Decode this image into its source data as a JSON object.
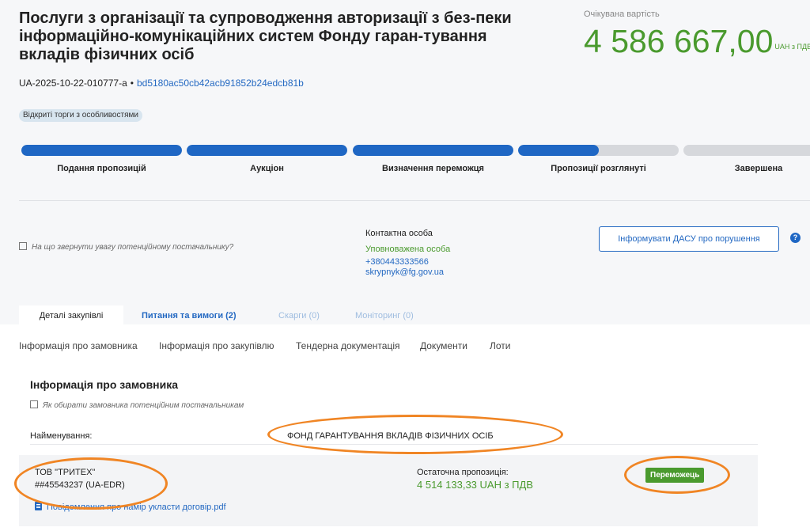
{
  "tender": {
    "title": "Послуги з організації та супроводження авторизації з без-пеки інформаційно-комунікаційних систем Фонду гаран-тування вкладів фізичних осіб",
    "id": "UA-2025-10-22-010777-a",
    "separator": "•",
    "hash": "bd5180ac50cb42acb91852b24edcb81b",
    "procedure_badge": "Відкриті торги з особливостями"
  },
  "expected_value": {
    "label": "Очікувана вартість",
    "amount": "4 586 667,00",
    "currency": "UAH з ПДВ"
  },
  "stages": [
    {
      "label": "Подання пропозицій",
      "progress": 1.0
    },
    {
      "label": "Аукціон",
      "progress": 1.0
    },
    {
      "label": "Визначення переможця",
      "progress": 1.0
    },
    {
      "label": "Пропозиції розглянуті",
      "progress": 0.5
    },
    {
      "label": "Завершена",
      "progress": 0.0
    }
  ],
  "hint_supplier": "На що звернути увагу потенційному постачальнику?",
  "contact": {
    "heading": "Контактна особа",
    "role": "Уповноважена особа",
    "phone": "+380443333566",
    "email": "skrypnyk@fg.gov.ua"
  },
  "dasu_button": "Інформувати ДАСУ про порушення",
  "help_icon_glyph": "?",
  "tabs": [
    {
      "label": "Деталі закупівлі"
    },
    {
      "label": "Питання та вимоги (2)"
    },
    {
      "label": "Скарги (0)"
    },
    {
      "label": "Моніторинг (0)"
    }
  ],
  "subnav": [
    {
      "label": "Інформація про замовника"
    },
    {
      "label": "Інформація про закупівлю"
    },
    {
      "label": "Тендерна документація"
    },
    {
      "label": "Документи"
    },
    {
      "label": "Лоти"
    }
  ],
  "customer": {
    "section_title": "Інформація про замовника",
    "hint": "Як обирати замовника потенційним постачальникам",
    "name_label": "Найменування:",
    "name_value": "ФОНД ГАРАНТУВАННЯ ВКЛАДІВ ФІЗИЧНИХ ОСІБ"
  },
  "winner": {
    "company": "ТОВ \"ТРИТЕХ\"",
    "edr": "##45543237 (UA-EDR)",
    "offer_label": "Остаточна пропозиція:",
    "offer_value": "4 514 133,33 UAH з ПДВ",
    "status_badge": "Переможець",
    "document_link": "Повідомлення про намір укласти договір.pdf"
  },
  "colors": {
    "accent_blue": "#1f67c4",
    "value_green": "#4a9a2e",
    "annotation_orange": "#f08524"
  }
}
